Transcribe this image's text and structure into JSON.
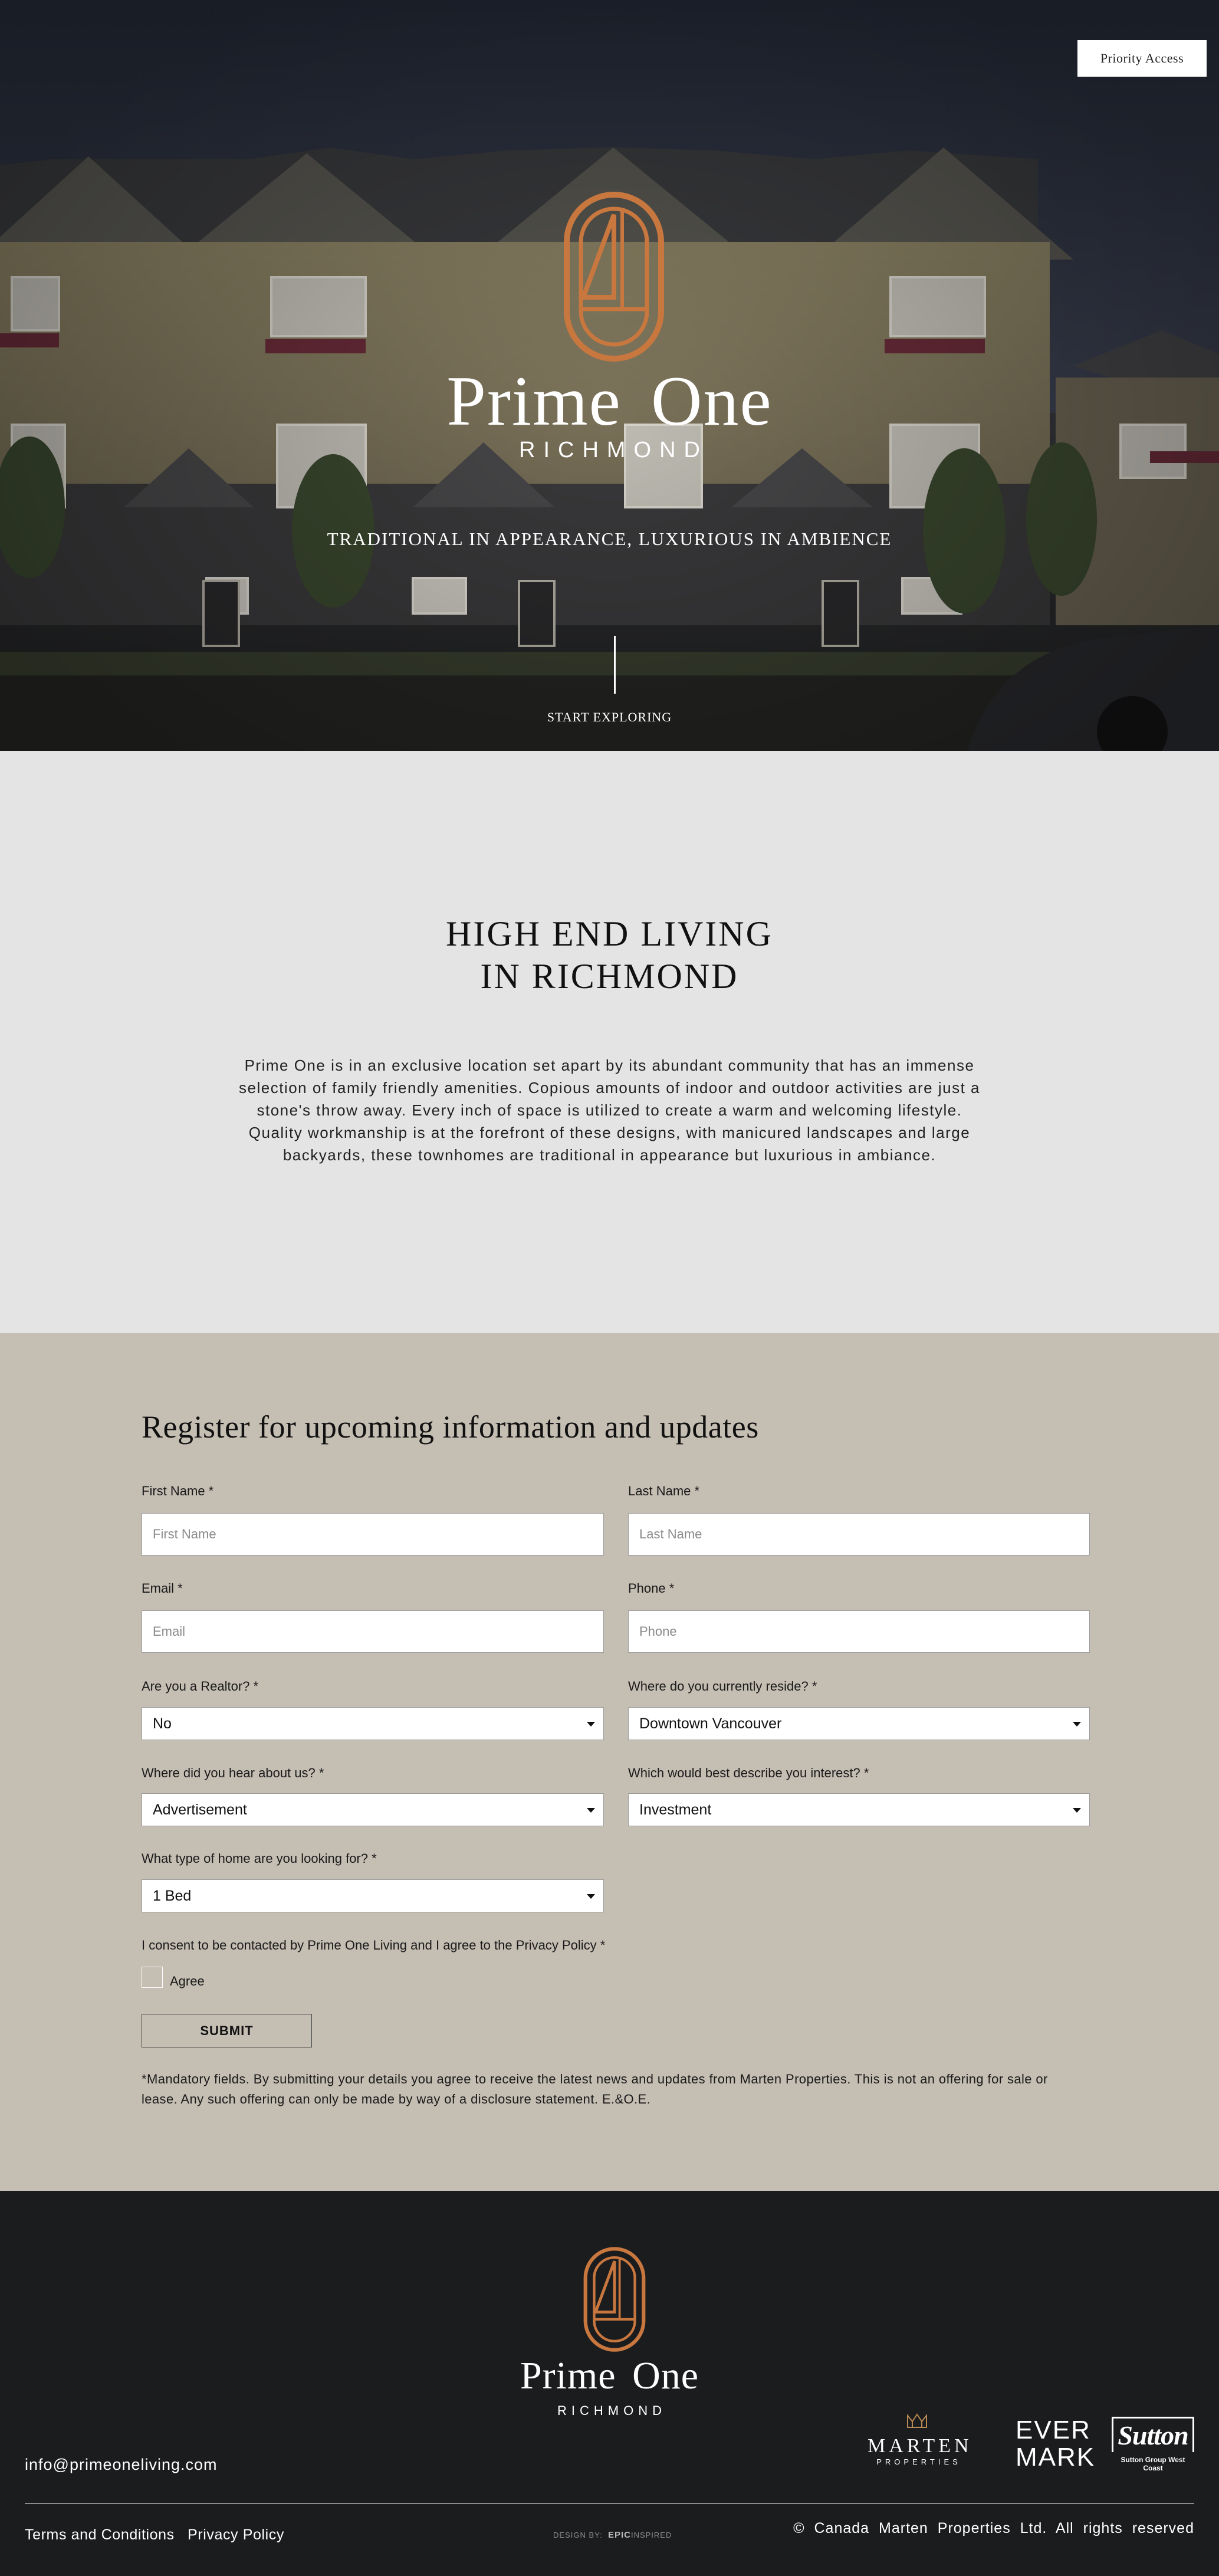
{
  "hero": {
    "priority_button": "Priority Access",
    "brand": "Prime One",
    "sub": "RICHMOND",
    "tagline": "TRADITIONAL IN APPEARANCE, LUXURIOUS IN AMBIENCE",
    "explore": "START EXPLORING"
  },
  "intro": {
    "title_line1": "HIGH END LIVING",
    "title_line2": "IN RICHMOND",
    "body": "Prime One is in an exclusive location set apart by its abundant community that has an immense selection of family friendly amenities. Copious amounts of indoor and outdoor activities are just a stone's throw away. Every inch of space is utilized to create a warm and welcoming lifestyle. Quality workmanship is at the forefront of these designs, with manicured landscapes and large backyards, these townhomes are traditional in appearance but luxurious in ambiance."
  },
  "form": {
    "title": "Register for upcoming information and updates",
    "first_name": {
      "label": "First Name *",
      "placeholder": "First Name"
    },
    "last_name": {
      "label": "Last Name *",
      "placeholder": "Last Name"
    },
    "email": {
      "label": "Email *",
      "placeholder": "Email"
    },
    "phone": {
      "label": "Phone *",
      "placeholder": "Phone"
    },
    "realtor": {
      "label": "Are you a Realtor? *",
      "value": "No"
    },
    "reside": {
      "label": "Where do you currently reside? *",
      "value": "Downtown Vancouver"
    },
    "heard": {
      "label": "Where did you hear about us? *",
      "value": "Advertisement"
    },
    "interest": {
      "label": "Which would best describe you interest? *",
      "value": "Investment"
    },
    "home_type": {
      "label": "What type of home are you looking for? *",
      "value": "1 Bed"
    },
    "consent_label": "I consent to be contacted by Prime One Living and I agree to the Privacy Policy *",
    "agree_label": "Agree",
    "submit": "SUBMIT",
    "disclaimer": "*Mandatory fields. By submitting your details you agree to receive the latest news and updates from Marten Properties. This is not an offering for sale or lease. Any such offering can only be made by way of a disclosure statement. E.&O.E."
  },
  "footer": {
    "brand": "Prime One",
    "sub": "RICHMOND",
    "email": "info@primeoneliving.com",
    "terms": "Terms and Conditions",
    "privacy": "Privacy Policy",
    "design_prefix": "DESIGN BY:",
    "design_epic": "EPIC",
    "design_inspired": "INSPIRED",
    "copyright": "© Canada Marten Properties Ltd.   All rights reserved",
    "partners": {
      "marten_name": "MARTEN",
      "marten_props": "PROPERTIES",
      "evermark_line1": "EVER",
      "evermark_line2": "MARK",
      "sutton_name": "Sutton",
      "sutton_sub": "Sutton Group West Coast"
    }
  },
  "colors": {
    "accent_copper": "#c8773f",
    "form_bg": "#c5beb3",
    "intro_bg": "#e4e4e4",
    "footer_bg": "#1b1c1e"
  }
}
